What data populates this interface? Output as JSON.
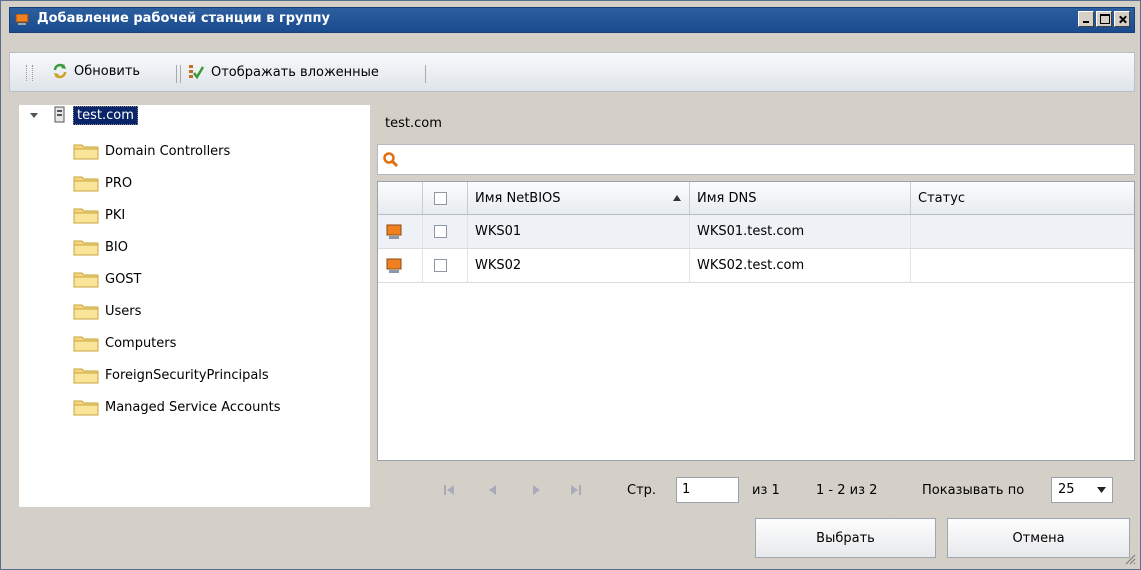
{
  "window": {
    "title": "Добавление рабочей станции в группу"
  },
  "toolbar": {
    "refresh_label": "Обновить",
    "show_nested_label": "Отображать вложенные"
  },
  "tree": {
    "root": "test.com",
    "items": [
      "Domain Controllers",
      "PRO",
      "PKI",
      "BIO",
      "GOST",
      "Users",
      "Computers",
      "ForeignSecurityPrincipals",
      "Managed Service Accounts"
    ]
  },
  "panel": {
    "title": "test.com",
    "search_value": ""
  },
  "grid": {
    "columns": [
      "Имя NetBIOS",
      "Имя DNS",
      "Статус"
    ],
    "rows": [
      {
        "netbios": "WKS01",
        "dns": "WKS01.test.com",
        "status": ""
      },
      {
        "netbios": "WKS02",
        "dns": "WKS02.test.com",
        "status": ""
      }
    ]
  },
  "pager": {
    "page_label": "Стр.",
    "page_value": "1",
    "of_label": "из 1",
    "range": "1 - 2 из 2",
    "show_label": "Показывать по",
    "page_size": "25"
  },
  "buttons": {
    "select": "Выбрать",
    "cancel": "Отмена"
  },
  "colors": {
    "title_bar": "#1f4f91",
    "selection": "#0a246a"
  }
}
